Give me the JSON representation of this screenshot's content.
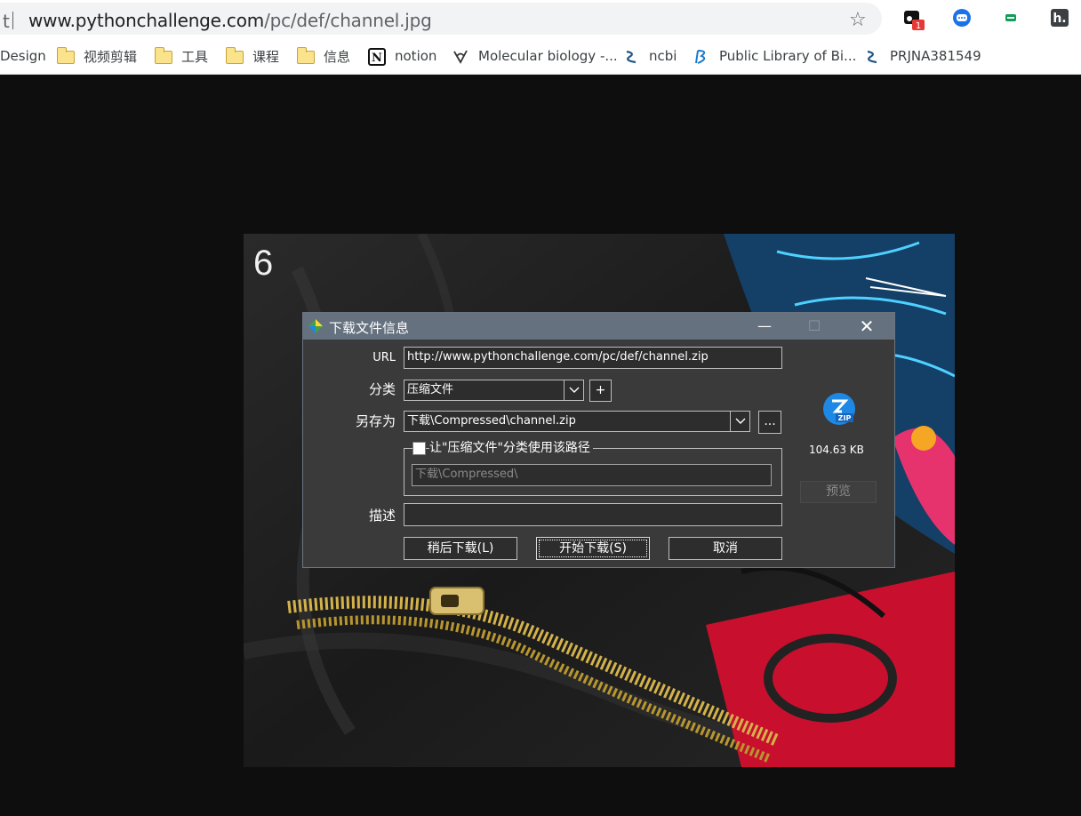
{
  "browser": {
    "omnibox_prefix": "t",
    "url_host": "www.pythonchallenge.com",
    "url_path": "/pc/def/channel.jpg",
    "bookmark_star_icon": "star-outline-icon",
    "extensions": [
      "ext-badge-icon",
      "ext-blue-circle-icon",
      "ext-green-icon",
      "ext-h-icon"
    ],
    "extension_badge_count": "1"
  },
  "bookmarks": [
    {
      "label": "Design",
      "icon": "none"
    },
    {
      "label": "视频剪辑",
      "icon": "folder-icon"
    },
    {
      "label": "工具",
      "icon": "folder-icon"
    },
    {
      "label": "课程",
      "icon": "folder-icon"
    },
    {
      "label": "信息",
      "icon": "folder-icon"
    },
    {
      "label": "notion",
      "icon": "notion-icon"
    },
    {
      "label": "Molecular biology -...",
      "icon": "molecule-icon"
    },
    {
      "label": "ncbi",
      "icon": "ncbi-icon"
    },
    {
      "label": "Public Library of Bi...",
      "icon": "plos-icon"
    },
    {
      "label": "PRJNA381549",
      "icon": "ncbi-icon"
    }
  ],
  "page": {
    "photo_number": "6"
  },
  "dialog": {
    "title": "下载文件信息",
    "url_label": "URL",
    "url_value": "http://www.pythonchallenge.com/pc/def/channel.zip",
    "category_label": "分类",
    "category_value": "压缩文件",
    "add_category": "+",
    "save_as_label": "另存为",
    "save_as_value": "下载\\Compressed\\channel.zip",
    "browse": "...",
    "remember_path_label": "让\"压缩文件\"分类使用该路径",
    "remember_path_checked": false,
    "default_path_placeholder": "下载\\Compressed\\",
    "description_label": "描述",
    "description_value": "",
    "file_size": "104.63  KB",
    "file_icon": "zip-icon",
    "preview": "预览",
    "later": "稍后下载(L)",
    "start": "开始下载(S)",
    "cancel": "取消"
  },
  "colors": {
    "dialog_bg": "#3a3a3a",
    "title_bar": "#65717f",
    "zip_icon_blue": "#1e88e5"
  }
}
